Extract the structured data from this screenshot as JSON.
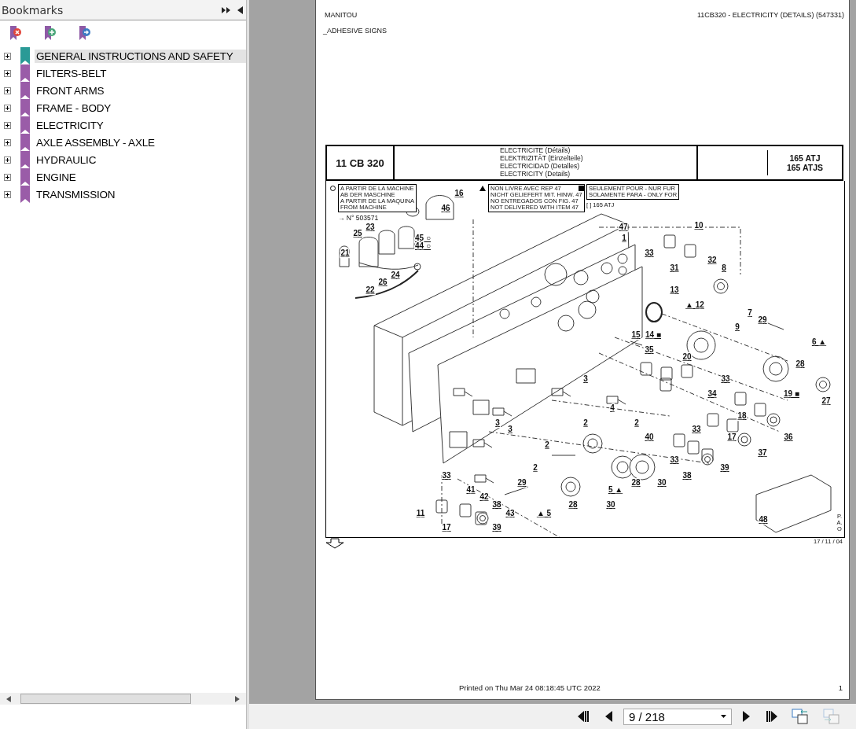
{
  "sidebar": {
    "title": "Bookmarks",
    "items": [
      {
        "label": "GENERAL INSTRUCTIONS AND SAFETY",
        "selected": true,
        "expanded": false,
        "color": "#2a9a96"
      },
      {
        "label": "FILTERS-BELT",
        "selected": false,
        "expanded": false,
        "color": "#9a5ca8"
      },
      {
        "label": "FRONT ARMS",
        "selected": false,
        "expanded": false,
        "color": "#9a5ca8"
      },
      {
        "label": "FRAME - BODY",
        "selected": false,
        "expanded": false,
        "color": "#9a5ca8"
      },
      {
        "label": "ELECTRICITY",
        "selected": false,
        "expanded": false,
        "color": "#9a5ca8"
      },
      {
        "label": "AXLE ASSEMBLY - AXLE",
        "selected": false,
        "expanded": false,
        "color": "#9a5ca8"
      },
      {
        "label": "HYDRAULIC",
        "selected": false,
        "expanded": false,
        "color": "#9a5ca8"
      },
      {
        "label": "ENGINE",
        "selected": false,
        "expanded": false,
        "color": "#9a5ca8"
      },
      {
        "label": "TRANSMISSION",
        "selected": false,
        "expanded": false,
        "color": "#9a5ca8"
      }
    ]
  },
  "page": {
    "brand": "MANITOU",
    "reference": "11CB320 - ELECTRICITY (DETAILS) (547331)",
    "section": "_ADHESIVE SIGNS",
    "title_block": {
      "code": "11 CB 320",
      "titles": [
        "ELECTRICITE (Détails)",
        "ELEKTRIZITÄT (Einzelteile)",
        "ELECTRICIDAD (Detalles)",
        "ELECTRICITY (Details)"
      ],
      "models": [
        "165 ATJ",
        "165 ATJS"
      ]
    },
    "notes": [
      {
        "kind": "circle",
        "lines": [
          "A PARTIR DE LA MACHINE",
          "AB DER MASCHINE",
          "A PARTIR DE LA MAQUINA",
          "FROM MACHINE"
        ],
        "extra": "→ N° 503571"
      },
      {
        "kind": "triangle",
        "lines": [
          "NON LIVRE AVEC  REP 47",
          "NICHT GELIEFERT MIT. HINW. 47",
          "NO ENTREGADOS CON FIG. 47",
          "NOT DELIVERED WITH ITEM 47"
        ]
      },
      {
        "kind": "square",
        "lines": [
          "SEULEMENT POUR - NUR FUR",
          "SOLAMENTE PARA - ONLY FOR"
        ],
        "extra": "[ ] 165 ATJ"
      }
    ],
    "callouts": [
      "16",
      "46",
      "23",
      "47",
      "10",
      "25",
      "45 ○",
      "1",
      "44 ○",
      "21",
      "33",
      "32",
      "31",
      "8",
      "24",
      "26",
      "22",
      "13",
      "▲ 12",
      "7",
      "29",
      "9",
      "15",
      "14 ■",
      "6 ▲",
      "35",
      "20",
      "28",
      "3",
      "33",
      "34",
      "19 ■",
      "27",
      "4",
      "18",
      "3",
      "2",
      "2",
      "3",
      "33",
      "40",
      "17",
      "36",
      "2",
      "37",
      "33",
      "2",
      "39",
      "33",
      "38",
      "29",
      "28",
      "30",
      "41",
      "5 ▲",
      "42",
      "38",
      "28",
      "30",
      "11",
      "43",
      "▲ 5",
      "48",
      "17",
      "39"
    ],
    "date_code": "17 / 11 / 04",
    "side_code": "P.A.O",
    "printed": "Printed on  Thu Mar 24 08:18:45 UTC 2022",
    "page_number": "1"
  },
  "toolbar": {
    "page_field": "9 / 218",
    "back_enabled": true,
    "forward_enabled": false
  }
}
